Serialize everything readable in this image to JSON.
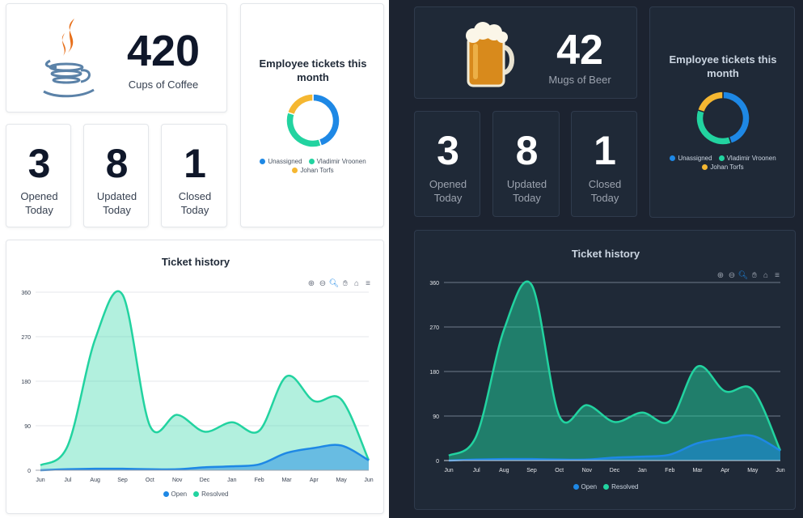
{
  "light": {
    "stat_value": "420",
    "stat_label": "Cups of Coffee",
    "tickets": [
      {
        "value": "3",
        "line1": "Opened",
        "line2": "Today"
      },
      {
        "value": "8",
        "line1": "Updated",
        "line2": "Today"
      },
      {
        "value": "1",
        "line1": "Closed",
        "line2": "Today"
      }
    ],
    "donut_title_1": "Employee tickets this",
    "donut_title_2": "month",
    "history_title": "Ticket history"
  },
  "dark": {
    "stat_value": "42",
    "stat_label": "Mugs of Beer",
    "tickets": [
      {
        "value": "3",
        "line1": "Opened",
        "line2": "Today"
      },
      {
        "value": "8",
        "line1": "Updated",
        "line2": "Today"
      },
      {
        "value": "1",
        "line1": "Closed",
        "line2": "Today"
      }
    ],
    "donut_title_1": "Employee tickets this",
    "donut_title_2": "month",
    "history_title": "Ticket history"
  },
  "donut_legend": [
    "Unassigned",
    "Vladimir Vroonen",
    "Johan Torfs"
  ],
  "history_legend": [
    "Open",
    "Resolved"
  ],
  "colors": {
    "open": "#1e88e5",
    "resolved": "#22d3a0",
    "johan": "#f5b731"
  },
  "icons": {
    "light_stat": "coffee-cup-icon",
    "dark_stat": "beer-mug-icon"
  },
  "toolbar_icons": [
    "zoom-in-icon",
    "zoom-out-icon",
    "selection-zoom-icon",
    "pan-hand-icon",
    "home-reset-icon",
    "menu-icon"
  ],
  "chart_data": [
    {
      "type": "pie",
      "title": "Employee tickets this month",
      "categories": [
        "Unassigned",
        "Vladimir Vroonen",
        "Johan Torfs"
      ],
      "values": [
        45,
        35,
        20
      ],
      "style": "donut"
    },
    {
      "type": "area",
      "title": "Ticket history",
      "categories": [
        "Jun",
        "Jul",
        "Aug",
        "Sep",
        "Oct",
        "Nov",
        "Dec",
        "Jan",
        "Feb",
        "Mar",
        "Apr",
        "May",
        "Jun"
      ],
      "series": [
        {
          "name": "Open",
          "values": [
            0,
            2,
            3,
            3,
            2,
            2,
            6,
            8,
            12,
            35,
            45,
            50,
            20
          ]
        },
        {
          "name": "Resolved",
          "values": [
            10,
            50,
            265,
            355,
            90,
            112,
            78,
            97,
            80,
            190,
            140,
            143,
            20
          ]
        }
      ],
      "yticks": [
        0,
        90,
        180,
        270,
        360
      ],
      "ylim": [
        0,
        360
      ],
      "legend": "bottom"
    }
  ]
}
